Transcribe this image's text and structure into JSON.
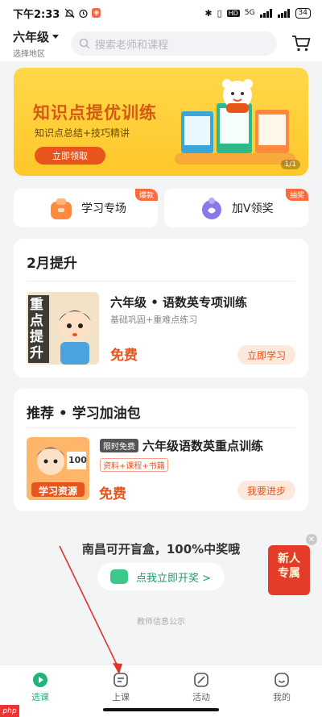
{
  "status_bar": {
    "time": "下午2:33",
    "network": "5G",
    "battery": "34"
  },
  "header": {
    "grade": "六年级",
    "region": "选择地区",
    "search_placeholder": "搜索老师和课程"
  },
  "banner": {
    "title": "知识点提优训练",
    "subtitle": "知识点总结+技巧精讲",
    "button": "立即领取",
    "pager": "1/1"
  },
  "quick_links": [
    {
      "label": "学习专场",
      "tag": "爆款",
      "icon": "study-bag-icon",
      "color": "#ff8a3d"
    },
    {
      "label": "加V领奖",
      "tag": "抽奖",
      "icon": "gift-purple-icon",
      "color": "#8a78e8"
    }
  ],
  "section_feb": {
    "title": "2月提升",
    "course": {
      "image_text": "重点提升",
      "title": "六年级 • 语数英专项训练",
      "subtitle": "基础巩固+重难点练习",
      "price": "免费",
      "button": "立即学习"
    }
  },
  "section_recommend": {
    "title": "推荐 • 学习加油包",
    "course": {
      "image_text": "学习资源",
      "image_number": "100",
      "badge": "限时免费",
      "title": "六年级语数英重点训练",
      "tag": "资料+课程+书籍",
      "price": "免费",
      "button": "我要进步"
    }
  },
  "promo": {
    "title": "南昌可开盲盒，100%中奖哦",
    "button": "点我立即开奖 >",
    "notice": "教师信息公示"
  },
  "new_user": {
    "label_line1": "新人",
    "label_line2": "专属"
  },
  "tabbar": [
    {
      "label": "选课",
      "icon": "play-circle-icon",
      "active": true
    },
    {
      "label": "上课",
      "icon": "lesson-icon",
      "active": false
    },
    {
      "label": "活动",
      "icon": "activity-icon",
      "active": false
    },
    {
      "label": "我的",
      "icon": "profile-icon",
      "active": false
    }
  ],
  "watermark": "php",
  "colors": {
    "accent": "#1fb578",
    "price": "#e8551c",
    "banner": "#ffc72a"
  }
}
